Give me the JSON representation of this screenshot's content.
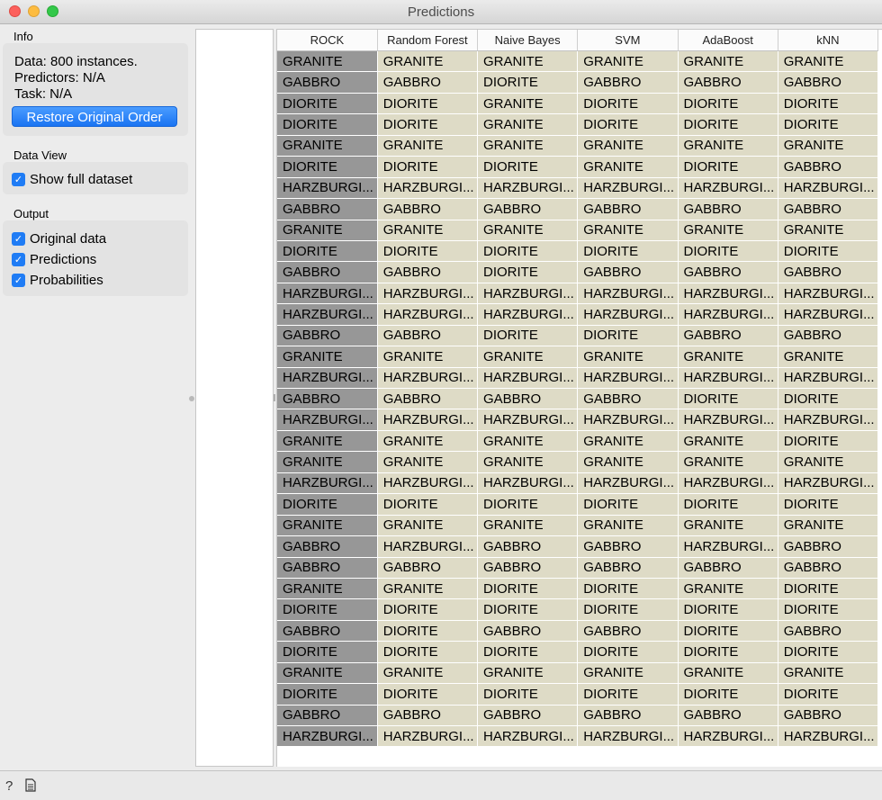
{
  "window": {
    "title": "Predictions"
  },
  "sidebar": {
    "info": {
      "label": "Info",
      "data_text": "Data: 800 instances.",
      "predictors_text": "Predictors: N/A",
      "task_text": "Task: N/A",
      "restore_button": "Restore Original Order"
    },
    "data_view": {
      "label": "Data View",
      "show_full": {
        "label": "Show full dataset",
        "checked": true
      }
    },
    "output": {
      "label": "Output",
      "items": [
        {
          "label": "Original data",
          "checked": true
        },
        {
          "label": "Predictions",
          "checked": true
        },
        {
          "label": "Probabilities",
          "checked": true
        }
      ]
    }
  },
  "table": {
    "columns": [
      "ROCK",
      "Random Forest",
      "Naive Bayes",
      "SVM",
      "AdaBoost",
      "kNN"
    ],
    "rows": [
      [
        "GRANITE",
        "GRANITE",
        "GRANITE",
        "GRANITE",
        "GRANITE",
        "GRANITE"
      ],
      [
        "GABBRO",
        "GABBRO",
        "DIORITE",
        "GABBRO",
        "GABBRO",
        "GABBRO"
      ],
      [
        "DIORITE",
        "DIORITE",
        "GRANITE",
        "DIORITE",
        "DIORITE",
        "DIORITE"
      ],
      [
        "DIORITE",
        "DIORITE",
        "GRANITE",
        "DIORITE",
        "DIORITE",
        "DIORITE"
      ],
      [
        "GRANITE",
        "GRANITE",
        "GRANITE",
        "GRANITE",
        "GRANITE",
        "GRANITE"
      ],
      [
        "DIORITE",
        "DIORITE",
        "DIORITE",
        "GRANITE",
        "DIORITE",
        "GABBRO"
      ],
      [
        "HARZBURGI...",
        "HARZBURGI...",
        "HARZBURGI...",
        "HARZBURGI...",
        "HARZBURGI...",
        "HARZBURGI..."
      ],
      [
        "GABBRO",
        "GABBRO",
        "GABBRO",
        "GABBRO",
        "GABBRO",
        "GABBRO"
      ],
      [
        "GRANITE",
        "GRANITE",
        "GRANITE",
        "GRANITE",
        "GRANITE",
        "GRANITE"
      ],
      [
        "DIORITE",
        "DIORITE",
        "DIORITE",
        "DIORITE",
        "DIORITE",
        "DIORITE"
      ],
      [
        "GABBRO",
        "GABBRO",
        "DIORITE",
        "GABBRO",
        "GABBRO",
        "GABBRO"
      ],
      [
        "HARZBURGI...",
        "HARZBURGI...",
        "HARZBURGI...",
        "HARZBURGI...",
        "HARZBURGI...",
        "HARZBURGI..."
      ],
      [
        "HARZBURGI...",
        "HARZBURGI...",
        "HARZBURGI...",
        "HARZBURGI...",
        "HARZBURGI...",
        "HARZBURGI..."
      ],
      [
        "GABBRO",
        "GABBRO",
        "DIORITE",
        "DIORITE",
        "GABBRO",
        "GABBRO"
      ],
      [
        "GRANITE",
        "GRANITE",
        "GRANITE",
        "GRANITE",
        "GRANITE",
        "GRANITE"
      ],
      [
        "HARZBURGI...",
        "HARZBURGI...",
        "HARZBURGI...",
        "HARZBURGI...",
        "HARZBURGI...",
        "HARZBURGI..."
      ],
      [
        "GABBRO",
        "GABBRO",
        "GABBRO",
        "GABBRO",
        "DIORITE",
        "DIORITE"
      ],
      [
        "HARZBURGI...",
        "HARZBURGI...",
        "HARZBURGI...",
        "HARZBURGI...",
        "HARZBURGI...",
        "HARZBURGI..."
      ],
      [
        "GRANITE",
        "GRANITE",
        "GRANITE",
        "GRANITE",
        "GRANITE",
        "DIORITE"
      ],
      [
        "GRANITE",
        "GRANITE",
        "GRANITE",
        "GRANITE",
        "GRANITE",
        "GRANITE"
      ],
      [
        "HARZBURGI...",
        "HARZBURGI...",
        "HARZBURGI...",
        "HARZBURGI...",
        "HARZBURGI...",
        "HARZBURGI..."
      ],
      [
        "DIORITE",
        "DIORITE",
        "DIORITE",
        "DIORITE",
        "DIORITE",
        "DIORITE"
      ],
      [
        "GRANITE",
        "GRANITE",
        "GRANITE",
        "GRANITE",
        "GRANITE",
        "GRANITE"
      ],
      [
        "GABBRO",
        "HARZBURGI...",
        "GABBRO",
        "GABBRO",
        "HARZBURGI...",
        "GABBRO"
      ],
      [
        "GABBRO",
        "GABBRO",
        "GABBRO",
        "GABBRO",
        "GABBRO",
        "GABBRO"
      ],
      [
        "GRANITE",
        "GRANITE",
        "DIORITE",
        "DIORITE",
        "GRANITE",
        "DIORITE"
      ],
      [
        "DIORITE",
        "DIORITE",
        "DIORITE",
        "DIORITE",
        "DIORITE",
        "DIORITE"
      ],
      [
        "GABBRO",
        "DIORITE",
        "GABBRO",
        "GABBRO",
        "DIORITE",
        "GABBRO"
      ],
      [
        "DIORITE",
        "DIORITE",
        "DIORITE",
        "DIORITE",
        "DIORITE",
        "DIORITE"
      ],
      [
        "GRANITE",
        "GRANITE",
        "GRANITE",
        "GRANITE",
        "GRANITE",
        "GRANITE"
      ],
      [
        "DIORITE",
        "DIORITE",
        "DIORITE",
        "DIORITE",
        "DIORITE",
        "DIORITE"
      ],
      [
        "GABBRO",
        "GABBRO",
        "GABBRO",
        "GABBRO",
        "GABBRO",
        "GABBRO"
      ],
      [
        "HARZBURGI...",
        "HARZBURGI...",
        "HARZBURGI...",
        "HARZBURGI...",
        "HARZBURGI...",
        "HARZBURGI..."
      ]
    ]
  },
  "statusbar": {
    "help_icon": "question-mark-icon",
    "report_icon": "document-icon"
  },
  "colors": {
    "rock_cell": "#979797",
    "prediction_cell": "#dedbc6",
    "accent": "#1f7cf5"
  }
}
